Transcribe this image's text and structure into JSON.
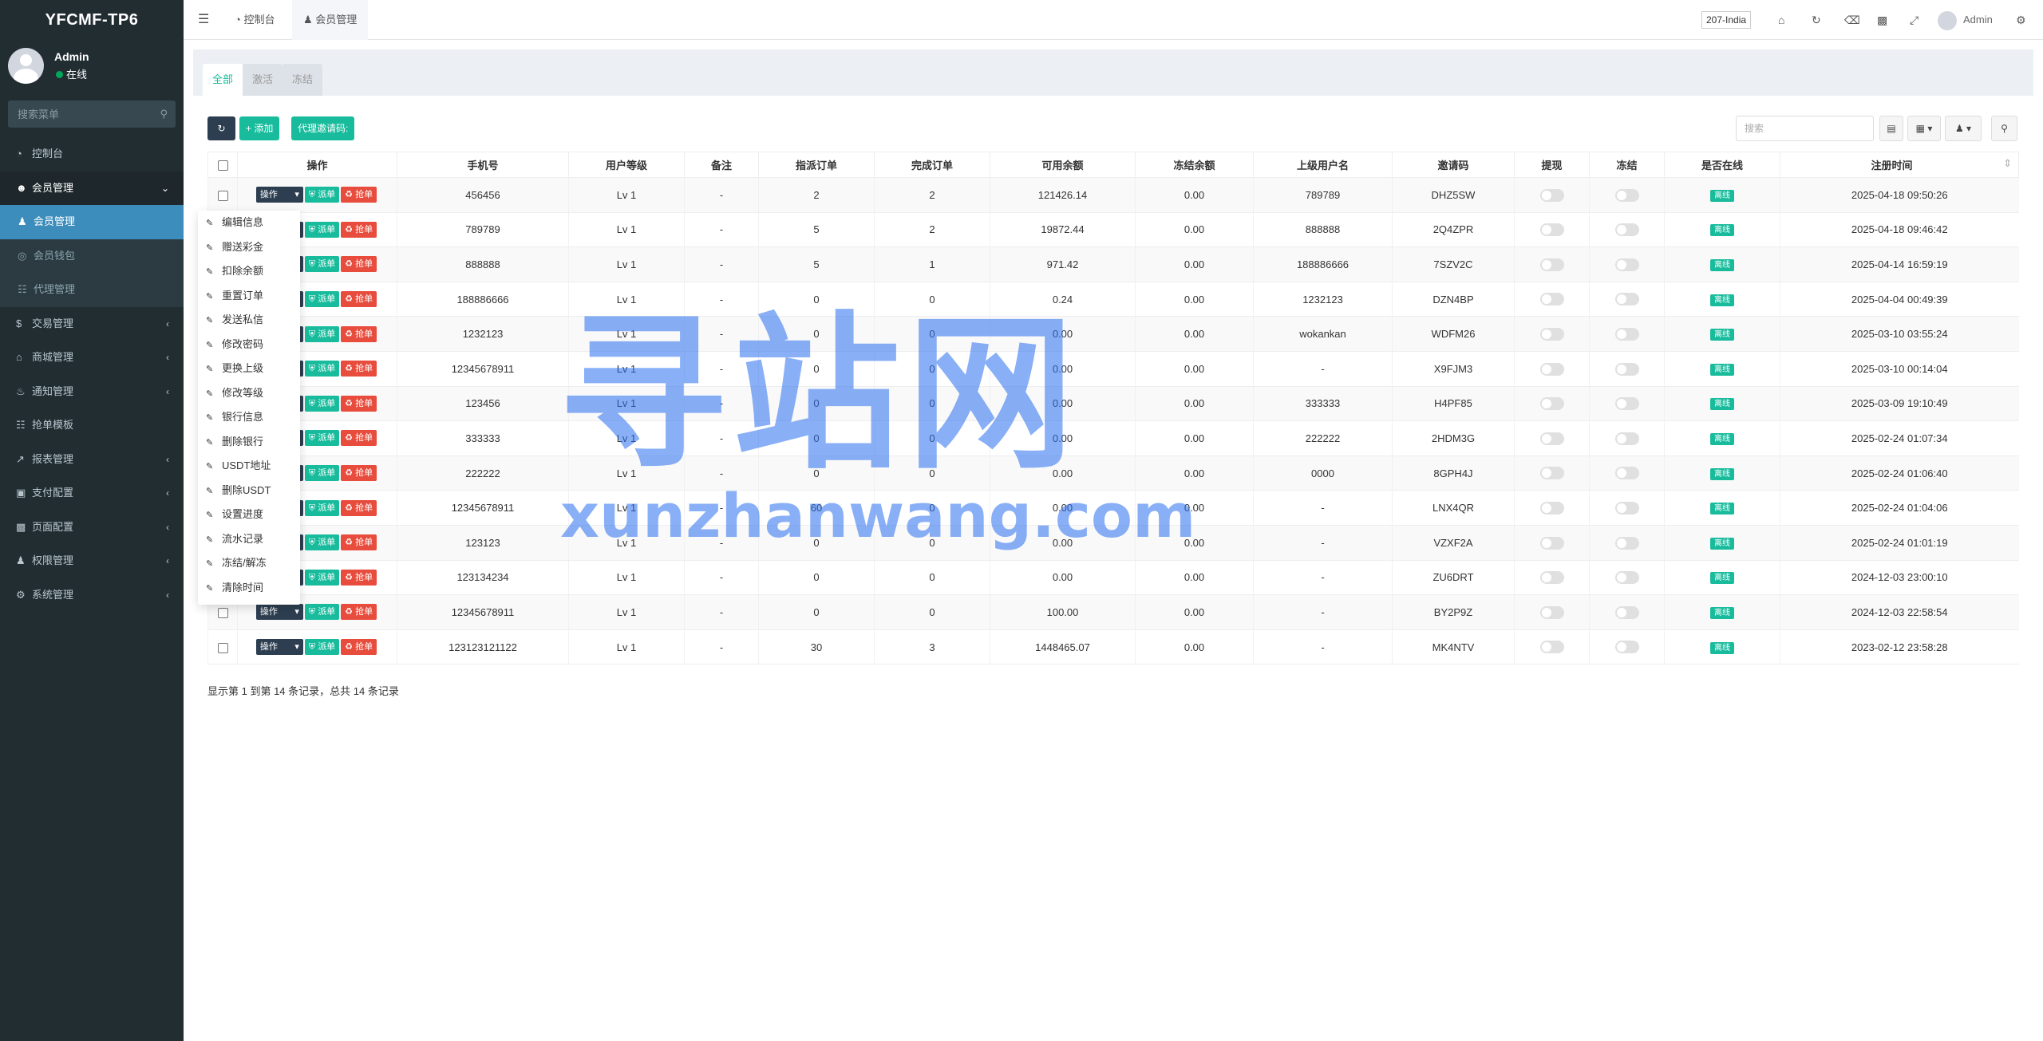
{
  "app": {
    "logo": "YFCMF-TP6"
  },
  "user": {
    "name": "Admin",
    "status": "在线"
  },
  "sidebar": {
    "search_placeholder": "搜索菜单",
    "items": [
      {
        "label": "控制台",
        "icon": "dashboard-icon"
      },
      {
        "label": "会员管理",
        "icon": "user-circle-icon"
      },
      {
        "label": "会员管理",
        "icon": "user-icon"
      },
      {
        "label": "会员钱包",
        "icon": "wallet-icon"
      },
      {
        "label": "代理管理",
        "icon": "sitemap-icon"
      },
      {
        "label": "交易管理",
        "icon": "dollar-icon"
      },
      {
        "label": "商城管理",
        "icon": "home-icon"
      },
      {
        "label": "通知管理",
        "icon": "bell-icon"
      },
      {
        "label": "抢单模板",
        "icon": "sitemap-icon"
      },
      {
        "label": "报表管理",
        "icon": "chart-icon"
      },
      {
        "label": "支付配置",
        "icon": "credit-card-icon"
      },
      {
        "label": "页面配置",
        "icon": "page-icon"
      },
      {
        "label": "权限管理",
        "icon": "users-icon"
      },
      {
        "label": "系统管理",
        "icon": "cogs-icon"
      }
    ]
  },
  "header": {
    "tabs": [
      {
        "label": "控制台"
      },
      {
        "label": "会员管理"
      }
    ],
    "lang": "207-India",
    "admin": "Admin"
  },
  "panel_tabs": [
    {
      "label": "全部"
    },
    {
      "label": "激活"
    },
    {
      "label": "冻结"
    }
  ],
  "toolbar": {
    "add": "添加",
    "invite": "代理邀请码:",
    "search_placeholder": "搜索"
  },
  "table": {
    "headers": [
      "操作",
      "手机号",
      "用户等级",
      "备注",
      "指派订单",
      "完成订单",
      "可用余额",
      "冻结余额",
      "上级用户名",
      "邀请码",
      "提现",
      "冻结",
      "是否在线",
      "注册时间"
    ],
    "action_labels": {
      "ops": "操作",
      "dispatch": "派单",
      "grab": "抢单"
    },
    "online_label": "离线",
    "rows": [
      {
        "phone": "456456",
        "level": "Lv 1",
        "note": "-",
        "assigned": "2",
        "done": "2",
        "balance": "121426.14",
        "frozen": "0.00",
        "parent": "789789",
        "code": "DHZ5SW",
        "time": "2025-04-18 09:50:26"
      },
      {
        "phone": "789789",
        "level": "Lv 1",
        "note": "-",
        "assigned": "5",
        "done": "2",
        "balance": "19872.44",
        "frozen": "0.00",
        "parent": "888888",
        "code": "2Q4ZPR",
        "time": "2025-04-18 09:46:42"
      },
      {
        "phone": "888888",
        "level": "Lv 1",
        "note": "-",
        "assigned": "5",
        "done": "1",
        "balance": "971.42",
        "frozen": "0.00",
        "parent": "188886666",
        "code": "7SZV2C",
        "time": "2025-04-14 16:59:19"
      },
      {
        "phone": "188886666",
        "level": "Lv 1",
        "note": "-",
        "assigned": "0",
        "done": "0",
        "balance": "0.24",
        "frozen": "0.00",
        "parent": "1232123",
        "code": "DZN4BP",
        "time": "2025-04-04 00:49:39"
      },
      {
        "phone": "1232123",
        "level": "Lv 1",
        "note": "-",
        "assigned": "0",
        "done": "0",
        "balance": "0.00",
        "frozen": "0.00",
        "parent": "wokankan",
        "code": "WDFM26",
        "time": "2025-03-10 03:55:24"
      },
      {
        "phone": "12345678911",
        "level": "Lv 1",
        "note": "-",
        "assigned": "0",
        "done": "0",
        "balance": "0.00",
        "frozen": "0.00",
        "parent": "-",
        "code": "X9FJM3",
        "time": "2025-03-10 00:14:04"
      },
      {
        "phone": "123456",
        "level": "Lv 1",
        "note": "-",
        "assigned": "0",
        "done": "0",
        "balance": "0.00",
        "frozen": "0.00",
        "parent": "333333",
        "code": "H4PF85",
        "time": "2025-03-09 19:10:49"
      },
      {
        "phone": "333333",
        "level": "Lv 1",
        "note": "-",
        "assigned": "0",
        "done": "0",
        "balance": "0.00",
        "frozen": "0.00",
        "parent": "222222",
        "code": "2HDM3G",
        "time": "2025-02-24 01:07:34"
      },
      {
        "phone": "222222",
        "level": "Lv 1",
        "note": "-",
        "assigned": "0",
        "done": "0",
        "balance": "0.00",
        "frozen": "0.00",
        "parent": "0000",
        "code": "8GPH4J",
        "time": "2025-02-24 01:06:40"
      },
      {
        "phone": "12345678911",
        "level": "Lv 1",
        "note": "-",
        "assigned": "60",
        "done": "0",
        "balance": "0.00",
        "frozen": "0.00",
        "parent": "-",
        "code": "LNX4QR",
        "time": "2025-02-24 01:04:06"
      },
      {
        "phone": "123123",
        "level": "Lv 1",
        "note": "-",
        "assigned": "0",
        "done": "0",
        "balance": "0.00",
        "frozen": "0.00",
        "parent": "-",
        "code": "VZXF2A",
        "time": "2025-02-24 01:01:19"
      },
      {
        "phone": "123134234",
        "level": "Lv 1",
        "note": "-",
        "assigned": "0",
        "done": "0",
        "balance": "0.00",
        "frozen": "0.00",
        "parent": "-",
        "code": "ZU6DRT",
        "time": "2024-12-03 23:00:10"
      },
      {
        "phone": "12345678911",
        "level": "Lv 1",
        "note": "-",
        "assigned": "0",
        "done": "0",
        "balance": "100.00",
        "frozen": "0.00",
        "parent": "-",
        "code": "BY2P9Z",
        "time": "2024-12-03 22:58:54"
      },
      {
        "phone": "123123121122",
        "level": "Lv 1",
        "note": "-",
        "assigned": "30",
        "done": "3",
        "balance": "1448465.07",
        "frozen": "0.00",
        "parent": "-",
        "code": "MK4NTV",
        "time": "2023-02-12 23:58:28"
      }
    ]
  },
  "dropdown": {
    "items": [
      {
        "label": "编辑信息",
        "icon": "pencil-icon"
      },
      {
        "label": "赠送彩金",
        "icon": "dollar-icon"
      },
      {
        "label": "扣除余额",
        "icon": "shield-icon"
      },
      {
        "label": "重置订单",
        "icon": "refresh-icon"
      },
      {
        "label": "发送私信",
        "icon": "pencil-icon"
      },
      {
        "label": "修改密码",
        "icon": "lock-icon"
      },
      {
        "label": "更换上级",
        "icon": "flag-icon"
      },
      {
        "label": "修改等级",
        "icon": "flag-icon"
      },
      {
        "label": "银行信息",
        "icon": "credit-card-icon"
      },
      {
        "label": "删除银行",
        "icon": "trash-icon"
      },
      {
        "label": "USDT地址",
        "icon": "mobile-icon"
      },
      {
        "label": "删除USDT",
        "icon": "bitcoin-icon"
      },
      {
        "label": "设置进度",
        "icon": "sliders-icon"
      },
      {
        "label": "流水记录",
        "icon": "line-chart-icon"
      },
      {
        "label": "冻结/解冻",
        "icon": "pencil-icon"
      },
      {
        "label": "清除时间",
        "icon": "refresh-icon"
      }
    ]
  },
  "footer": {
    "summary": "显示第 1 到第 14 条记录，总共 14 条记录"
  },
  "watermark": {
    "cn": "寻站网",
    "en": "xunzhanwang.com"
  },
  "colors": {
    "sidebar": "#222d32",
    "active": "#3c8dbc",
    "green": "#18bc9c",
    "red": "#e74c3c",
    "dark": "#2c3e50"
  }
}
